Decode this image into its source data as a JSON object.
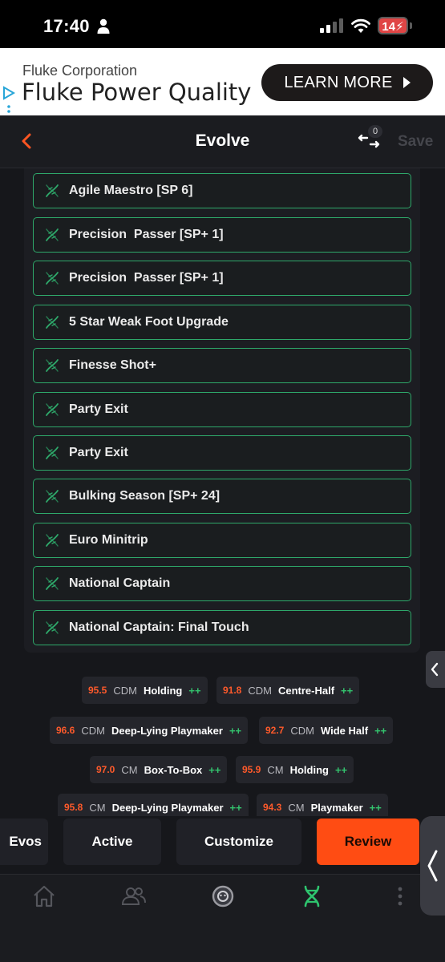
{
  "status_bar": {
    "time": "17:40",
    "battery": "14"
  },
  "ad": {
    "company": "Fluke Corporation",
    "headline": "Fluke Power Quality",
    "cta": "LEARN MORE"
  },
  "header": {
    "title": "Evolve",
    "swap_count": "0",
    "save_label": "Save"
  },
  "evolutions": [
    "Agile Maestro [SP 6]",
    "Precision  Passer [SP+ 1]",
    "Precision  Passer [SP+ 1]",
    "5 Star Weak Foot Upgrade",
    "Finesse Shot+",
    "Party Exit",
    "Party Exit",
    "Bulking Season [SP+ 24]",
    "Euro Minitrip",
    "National Captain",
    "National Captain: Final Touch"
  ],
  "roles": [
    {
      "rating": "95.5",
      "position": "CDM",
      "role": "Holding",
      "plus": "++"
    },
    {
      "rating": "91.8",
      "position": "CDM",
      "role": "Centre-Half",
      "plus": "++"
    },
    {
      "rating": "96.6",
      "position": "CDM",
      "role": "Deep-Lying Playmaker",
      "plus": "++"
    },
    {
      "rating": "92.7",
      "position": "CDM",
      "role": "Wide Half",
      "plus": "++"
    },
    {
      "rating": "97.0",
      "position": "CM",
      "role": "Box-To-Box",
      "plus": "++"
    },
    {
      "rating": "95.9",
      "position": "CM",
      "role": "Holding",
      "plus": "++"
    },
    {
      "rating": "95.8",
      "position": "CM",
      "role": "Deep-Lying Playmaker",
      "plus": "++"
    },
    {
      "rating": "94.3",
      "position": "CM",
      "role": "Playmaker",
      "plus": "++"
    }
  ],
  "tabs": {
    "evos": "Evos",
    "active": "Active",
    "customize": "Customize",
    "review": "Review"
  },
  "colors": {
    "accent": "#ff4c13",
    "evo_border": "#2ea86a",
    "plus": "#33c26d",
    "rating": "#ff5a2b"
  },
  "nav_icons": [
    "home-icon",
    "players-icon",
    "club-icon",
    "evolution-icon",
    "more-icon"
  ]
}
